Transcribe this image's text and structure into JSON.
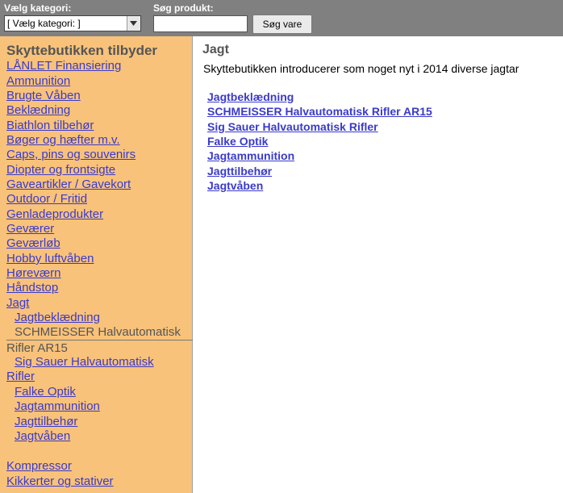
{
  "header": {
    "category_label": "Vælg kategori:",
    "category_selected": "[ Vælg kategori: ]",
    "search_label": "Søg produkt:",
    "search_value": "",
    "search_button": "Søg vare"
  },
  "sidebar": {
    "title": "Skyttebutikken tilbyder",
    "items": [
      "LÅNLET Finansiering",
      "Ammunition",
      "Brugte Våben",
      "Beklædning",
      "Biathlon tilbehør",
      "Bøger og hæfter m.v.",
      "Caps, pins og souvenirs",
      "Diopter og frontsigte",
      "Gaveartikler / Gavekort",
      "Outdoor / Fritid",
      "Genladeprodukter",
      "Geværer",
      "Geværløb",
      "Hobby luftvåben",
      "Høreværn",
      "Håndstop",
      "Jagt"
    ],
    "subitems_a": [
      "Jagtbeklædning",
      "SCHMEISSER Halvautomatisk"
    ],
    "wrap_text": "Rifler AR15",
    "subitem_sig": "Sig Sauer Halvautomatisk",
    "wrap_text2": "Rifler",
    "subitems_b": [
      "Falke Optik",
      "Jagtammunition",
      "Jagttilbehør",
      "Jagtvåben"
    ],
    "items_after": [
      "Kompressor",
      "Kikkerter og stativer"
    ]
  },
  "main": {
    "title": "Jagt",
    "intro": "Skyttebutikken introducerer som noget nyt i 2014 diverse jagtar",
    "links": [
      "Jagtbeklædning",
      "SCHMEISSER Halvautomatisk Rifler AR15",
      "Sig Sauer Halvautomatisk Rifler",
      "Falke Optik",
      "Jagtammunition",
      "Jagttilbehør",
      "Jagtvåben"
    ]
  },
  "colors": {
    "topbar": "#808080",
    "sidebar": "#f8c27a",
    "link": "#3a3acc"
  }
}
